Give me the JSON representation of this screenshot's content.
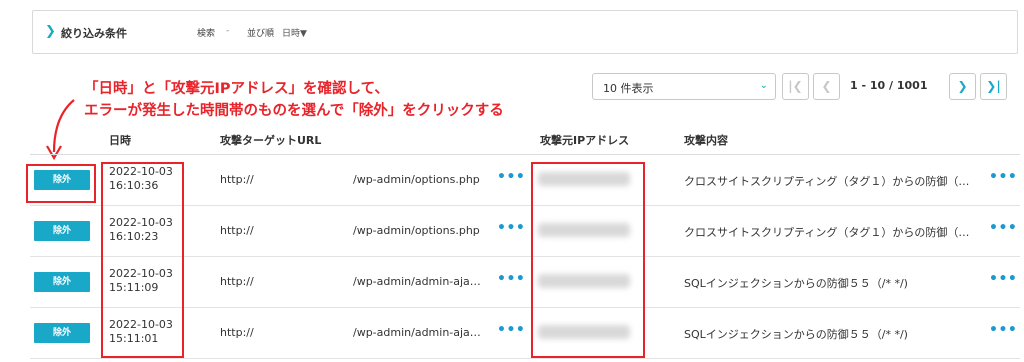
{
  "filter": {
    "title": "絞り込み条件",
    "search_label": "検索",
    "search_value": "-",
    "sort_label": "並び順",
    "sort_value": "日時▼"
  },
  "annotation": {
    "line1": "「日時」と「攻撃元IPアドレス」を確認して、",
    "line2": "エラーが発生した時間帯のものを選んで「除外」をクリックする"
  },
  "pagination": {
    "per_page": "10 件表示",
    "info": "1 - 10 / 1001"
  },
  "table": {
    "headers": {
      "date": "日時",
      "url": "攻撃ターゲットURL",
      "ip": "攻撃元IPアドレス",
      "attack": "攻撃内容"
    },
    "rows": [
      {
        "button": "除外",
        "date": "2022-10-03",
        "time": "16:10:36",
        "host": "http://",
        "path": "/wp-admin/options.php",
        "attack": "クロスサイトスクリプティング（タグ１）からの防御（…"
      },
      {
        "button": "除外",
        "date": "2022-10-03",
        "time": "16:10:23",
        "host": "http://",
        "path": "/wp-admin/options.php",
        "attack": "クロスサイトスクリプティング（タグ１）からの防御（…"
      },
      {
        "button": "除外",
        "date": "2022-10-03",
        "time": "15:11:09",
        "host": "http://",
        "path": "/wp-admin/admin-aja…",
        "attack": "SQLインジェクションからの防御５５（/* */)"
      },
      {
        "button": "除外",
        "date": "2022-10-03",
        "time": "15:11:01",
        "host": "http://",
        "path": "/wp-admin/admin-aja…",
        "attack": "SQLインジェクションからの防御５５（/* */)"
      }
    ]
  },
  "colors": {
    "accent": "#1aa8c8",
    "annotation": "#e8242a"
  }
}
